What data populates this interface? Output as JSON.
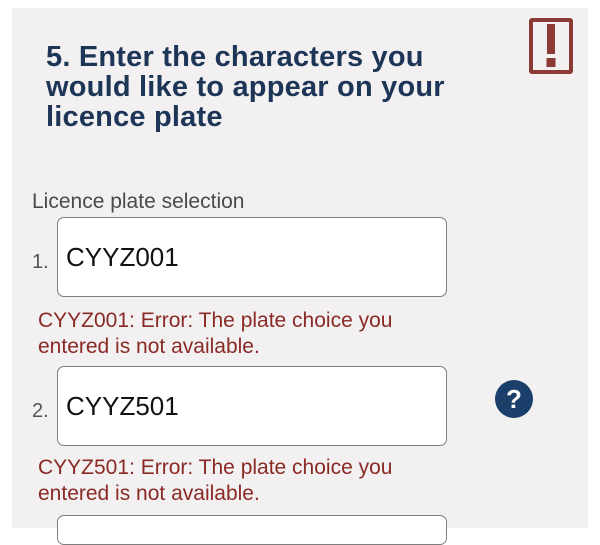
{
  "header": {
    "title": "5. Enter the characters you would like to appear on your licence plate",
    "alert_icon": "exclamation-box-icon"
  },
  "plate_selection": {
    "label": "Licence plate selection",
    "entries": [
      {
        "number": "1.",
        "value": "CYYZ001",
        "error": "CYYZ001: Error: The plate choice you entered is not available."
      },
      {
        "number": "2.",
        "value": "CYYZ501",
        "error": "CYYZ501: Error: The plate choice you entered is not available."
      }
    ],
    "help_label": "?"
  },
  "colors": {
    "title": "#1d3557",
    "error": "#8a2a26",
    "help_button": "#1b3f6b",
    "alert_icon": "#8c3a35"
  }
}
